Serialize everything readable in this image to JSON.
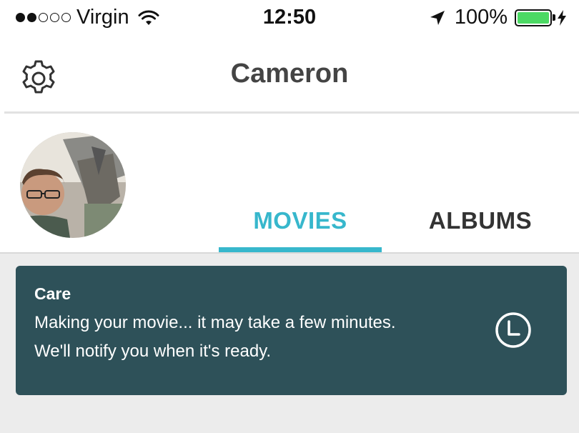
{
  "status_bar": {
    "signal_dots_filled": 2,
    "signal_dots_total": 5,
    "carrier": "Virgin",
    "time": "12:50",
    "battery_percent": "100%",
    "battery_level": 1.0,
    "icons": [
      "wifi-icon",
      "location-arrow-icon",
      "battery-icon",
      "charging-bolt-icon"
    ]
  },
  "nav": {
    "title": "Cameron",
    "settings_icon": "gear-icon"
  },
  "tabs": [
    {
      "label": "MOVIES",
      "active": true
    },
    {
      "label": "ALBUMS",
      "active": false
    }
  ],
  "card": {
    "title": "Care",
    "line1": "Making your movie... it may take a few minutes.",
    "line2": "We'll notify you when it's ready.",
    "icon": "clock-icon"
  },
  "colors": {
    "accent": "#37b7cc",
    "card_bg": "#2e5159",
    "content_bg": "#ececec",
    "battery_green": "#4cd964"
  }
}
